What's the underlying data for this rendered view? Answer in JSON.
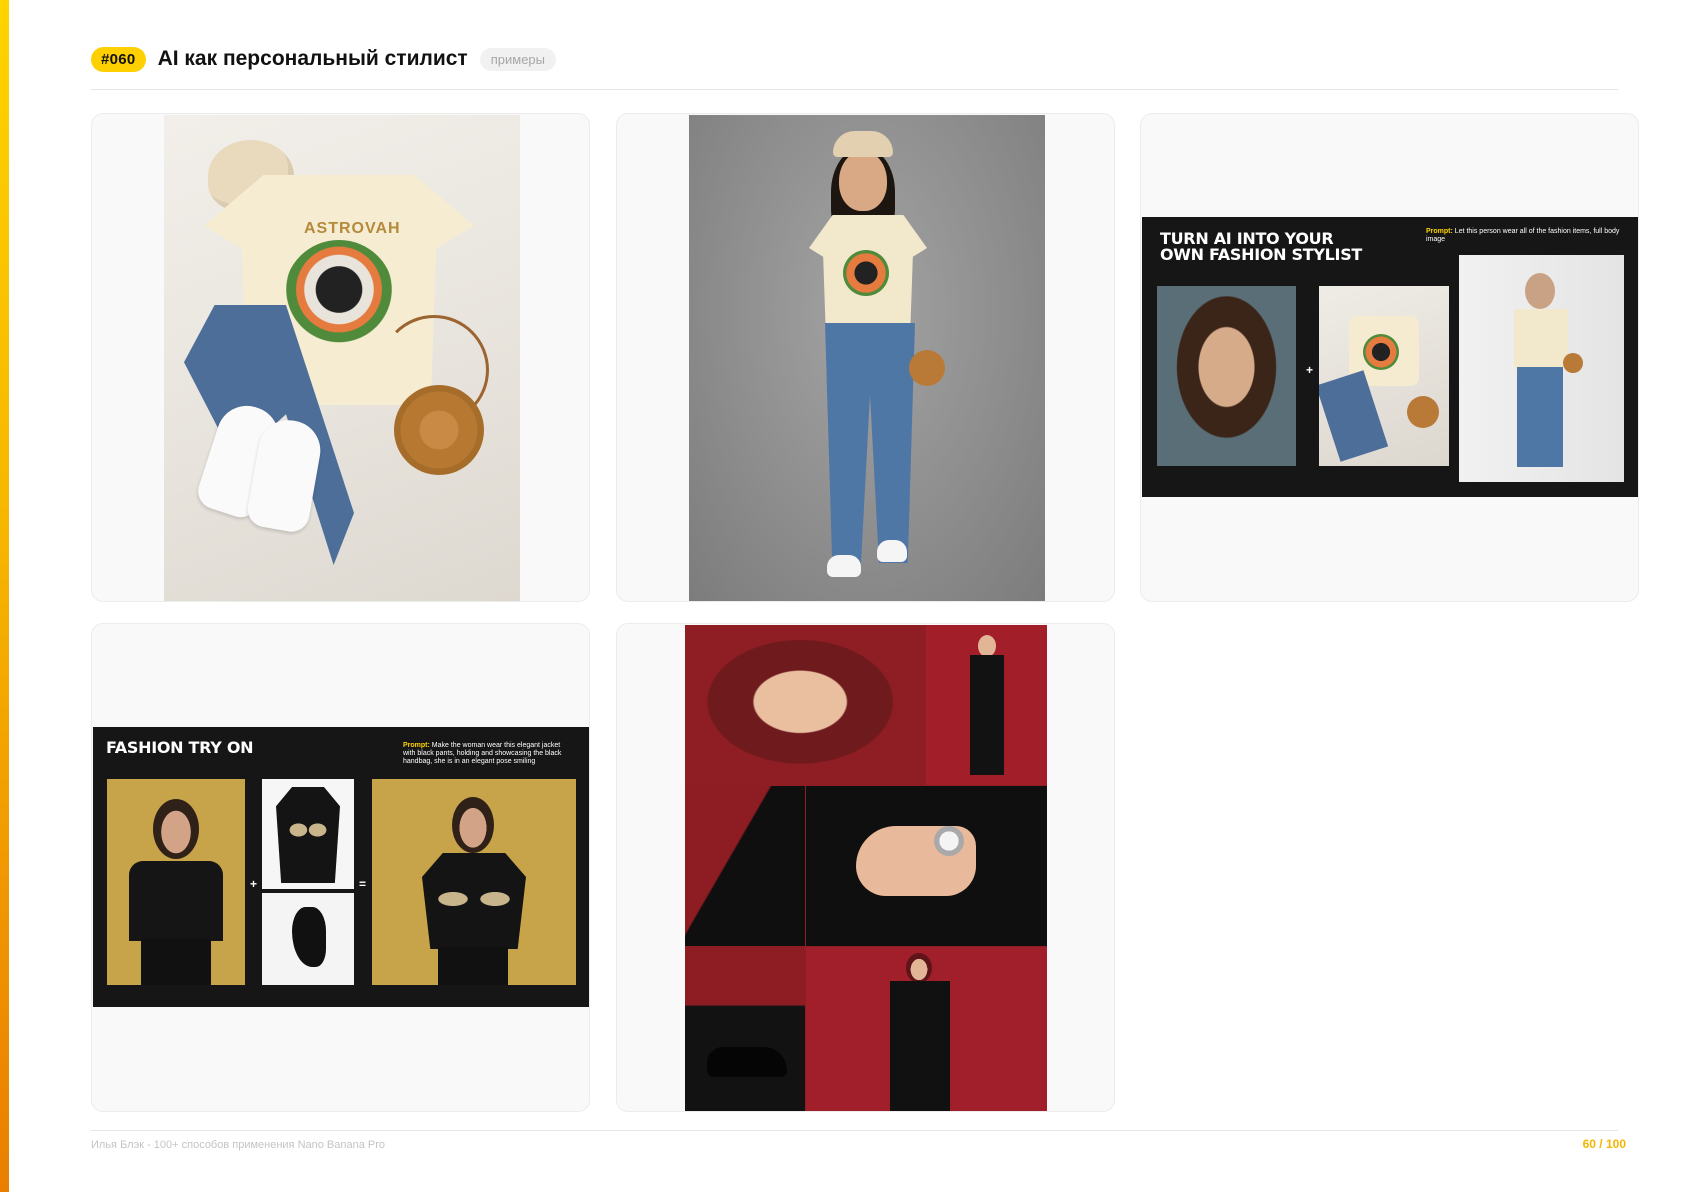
{
  "header": {
    "number": "#060",
    "title": "AI как персональный стилист",
    "tag": "примеры"
  },
  "cards": {
    "flatlay": {
      "tee_print": "ASTROVAH"
    },
    "stylist": {
      "title_line1": "TURN AI INTO YOUR",
      "title_line2": "OWN FASHION STYLIST",
      "prompt_label": "Prompt:",
      "prompt_text": "Let this person wear all of the fashion items, full body image",
      "plus": "+"
    },
    "tryon": {
      "title": "FASHION TRY ON",
      "prompt_label": "Prompt:",
      "prompt_text": "Make the woman wear this elegant jacket with black pants, holding and showcasing the black handbag, she is in an elegant pose smiling",
      "plus": "+",
      "equals": "="
    }
  },
  "footer": {
    "credit": "Илья Блэк - 100+ способов применения Nano Banana Pro",
    "page_indicator": "60 / 100"
  },
  "colors": {
    "accent": "#ffd000",
    "accent_gradient_end": "#ea7e00",
    "page_indicator": "#f2b600"
  }
}
